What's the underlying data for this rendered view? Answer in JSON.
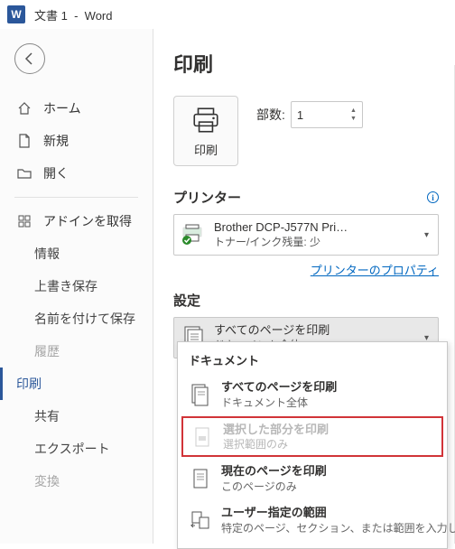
{
  "titlebar": {
    "doc": "文書 1",
    "app": "Word"
  },
  "sidebar": {
    "home": "ホーム",
    "new": "新規",
    "open": "開く",
    "addins": "アドインを取得",
    "info": "情報",
    "saveover": "上書き保存",
    "saveas": "名前を付けて保存",
    "history": "履歴",
    "print": "印刷",
    "share": "共有",
    "export": "エクスポート",
    "transform": "変換"
  },
  "print": {
    "title": "印刷",
    "btn": "印刷",
    "copies_label": "部数:",
    "copies_value": "1"
  },
  "printer": {
    "label": "プリンター",
    "name": "Brother DCP-J577N Pri…",
    "status": "トナー/インク残量: 少",
    "props_link": "プリンターのプロパティ"
  },
  "settings": {
    "label": "設定",
    "dd_l1": "すべてのページを印刷",
    "dd_l2": "ドキュメント全体"
  },
  "popup": {
    "header": "ドキュメント",
    "items": [
      {
        "l1": "すべてのページを印刷",
        "l2": "ドキュメント全体"
      },
      {
        "l1": "選択した部分を印刷",
        "l2": "選択範囲のみ"
      },
      {
        "l1": "現在のページを印刷",
        "l2": "このページのみ"
      },
      {
        "l1": "ユーザー指定の範囲",
        "l2": "特定のページ、セクション、または範囲を入力します"
      }
    ]
  }
}
